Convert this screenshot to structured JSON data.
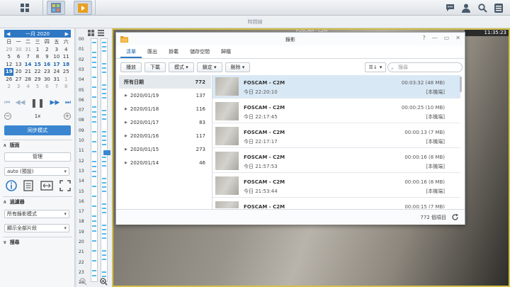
{
  "topbar": {
    "home_icon": "dashboard-icon",
    "surveillance_icon": "monitor-center-icon",
    "recording_icon": "recording-icon",
    "right_icons": [
      "chat-icon",
      "user-icon",
      "search-icon",
      "options-icon"
    ]
  },
  "subbar": {
    "title": "時間線"
  },
  "calendar": {
    "month_label": "一月 2020",
    "weekdays": [
      "日",
      "一",
      "二",
      "三",
      "四",
      "五",
      "六"
    ],
    "weeks": [
      [
        {
          "d": "29",
          "o": true
        },
        {
          "d": "30",
          "o": true
        },
        {
          "d": "31",
          "o": true
        },
        {
          "d": "1"
        },
        {
          "d": "2"
        },
        {
          "d": "3"
        },
        {
          "d": "4"
        }
      ],
      [
        {
          "d": "5"
        },
        {
          "d": "6"
        },
        {
          "d": "7"
        },
        {
          "d": "8"
        },
        {
          "d": "9"
        },
        {
          "d": "10"
        },
        {
          "d": "11"
        }
      ],
      [
        {
          "d": "12"
        },
        {
          "d": "13"
        },
        {
          "d": "14",
          "b": true
        },
        {
          "d": "15",
          "b": true
        },
        {
          "d": "16",
          "b": true
        },
        {
          "d": "17",
          "b": true
        },
        {
          "d": "18",
          "b": true
        }
      ],
      [
        {
          "d": "19",
          "sel": true
        },
        {
          "d": "20"
        },
        {
          "d": "21"
        },
        {
          "d": "22"
        },
        {
          "d": "23"
        },
        {
          "d": "24"
        },
        {
          "d": "25"
        }
      ],
      [
        {
          "d": "26"
        },
        {
          "d": "27"
        },
        {
          "d": "28"
        },
        {
          "d": "29"
        },
        {
          "d": "30"
        },
        {
          "d": "31"
        },
        {
          "d": "1",
          "o": true
        }
      ],
      [
        {
          "d": "2",
          "o": true
        },
        {
          "d": "3",
          "o": true
        },
        {
          "d": "4",
          "o": true
        },
        {
          "d": "5",
          "o": true
        },
        {
          "d": "6",
          "o": true
        },
        {
          "d": "7",
          "o": true
        },
        {
          "d": "8",
          "o": true
        }
      ]
    ]
  },
  "playback": {
    "speed": "1x",
    "sync_label": "同步模式"
  },
  "layout_section": {
    "title": "版面",
    "manage_label": "管理",
    "layout_value": "auto (預設)"
  },
  "filter_section": {
    "title": "過濾器",
    "mode_value": "所有錄影模式",
    "segment_value": "顯示全部片段"
  },
  "search_section": {
    "title": "搜尋"
  },
  "timeline": {
    "hours": [
      "00",
      "01",
      "02",
      "03",
      "04",
      "05",
      "06",
      "07",
      "08",
      "09",
      "10",
      "11",
      "12",
      "13",
      "14",
      "15",
      "16",
      "17",
      "18",
      "19",
      "20",
      "21",
      "22",
      "23",
      "24"
    ]
  },
  "video": {
    "clock": "11:35:23",
    "camera_label": "FOSCAM - C2M"
  },
  "dialog": {
    "title": "錄影",
    "tabs": [
      "清單",
      "匯出",
      "掛載",
      "儲存空間",
      "歸檔"
    ],
    "toolbar": [
      "播放",
      "下載",
      "模式",
      "鎖定",
      "刪除"
    ],
    "search_placeholder": "搜尋",
    "dates": [
      {
        "label": "所有日期",
        "count": "772",
        "all": true
      },
      {
        "label": "2020/01/19",
        "count": "137"
      },
      {
        "label": "2020/01/18",
        "count": "116"
      },
      {
        "label": "2020/01/17",
        "count": "83"
      },
      {
        "label": "2020/01/16",
        "count": "117"
      },
      {
        "label": "2020/01/15",
        "count": "273"
      },
      {
        "label": "2020/01/14",
        "count": "46"
      }
    ],
    "recordings": [
      {
        "name": "FOSCAM - C2M",
        "time": "今日 22:20:10",
        "duration": "00:03:32 (48 MB)",
        "location": "[本機端]",
        "selected": true
      },
      {
        "name": "FOSCAM - C2M",
        "time": "今日 22:17:45",
        "duration": "00:00:25 (10 MB)",
        "location": "[本機端]"
      },
      {
        "name": "FOSCAM - C2M",
        "time": "今日 22:17:17",
        "duration": "00:00:13 (7 MB)",
        "location": "[本機端]"
      },
      {
        "name": "FOSCAM - C2M",
        "time": "今日 21:57:53",
        "duration": "00:00:16 (8 MB)",
        "location": "[本機端]"
      },
      {
        "name": "FOSCAM - C2M",
        "time": "今日 21:53:44",
        "duration": "00:00:16 (8 MB)",
        "location": "[本機端]"
      },
      {
        "name": "FOSCAM - C2M",
        "time": "",
        "duration": "00:00:15 (7 MB)",
        "location": ""
      }
    ],
    "footer_count": "772 個項目"
  }
}
